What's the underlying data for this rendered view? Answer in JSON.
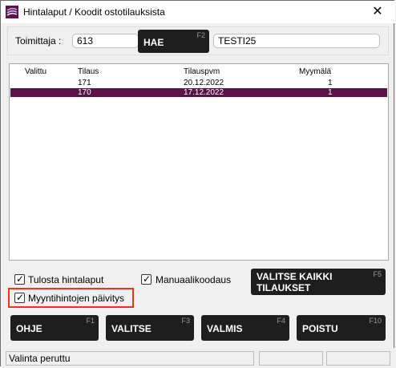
{
  "window": {
    "title": "Hintalaput / Koodit ostotilauksista",
    "close_glyph": "✕"
  },
  "toolbar": {
    "supplier_label": "Toimittaja :",
    "supplier_value": "613",
    "search_label": "HAE",
    "search_key": "F2",
    "supplier_name": "TESTI25"
  },
  "orders": {
    "headers": {
      "selected": "Valittu",
      "order": "Tilaus",
      "date": "Tilauspvm",
      "store": "Myymälä"
    },
    "rows": [
      {
        "selected": "",
        "order": "171",
        "date": "20.12.2022",
        "store": "1",
        "highlighted": false
      },
      {
        "selected": "",
        "order": "170",
        "date": "17.12.2022",
        "store": "1",
        "highlighted": true
      }
    ]
  },
  "options": {
    "print_labels": {
      "label": "Tulosta hintalaput",
      "checked": true
    },
    "manual_codes": {
      "label": "Manuaalikoodaus",
      "checked": true
    },
    "price_update": {
      "label": "Myyntihintojen päivitys",
      "checked": true
    }
  },
  "buttons": {
    "select_all": {
      "line1": "VALITSE KAIKKI",
      "line2": "TILAUKSET",
      "key": "F5"
    },
    "help": {
      "label": "OHJE",
      "key": "F1"
    },
    "select": {
      "label": "VALITSE",
      "key": "F3"
    },
    "done": {
      "label": "VALMIS",
      "key": "F4"
    },
    "remove": {
      "label": "POISTU",
      "key": "F10"
    }
  },
  "status": {
    "message": "Valinta peruttu",
    "field2": "",
    "field3": ""
  },
  "colors": {
    "selection": "#5a1348",
    "button": "#1e1e1e",
    "highlight_border": "#e8361d"
  },
  "icons": {
    "app": "app-logo-icon",
    "close": "close-icon",
    "checkbox": "checkmark-icon"
  }
}
